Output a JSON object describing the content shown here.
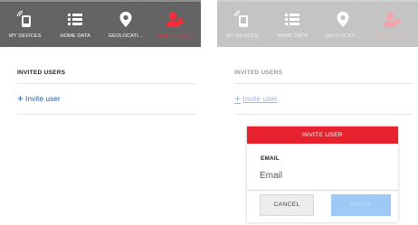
{
  "colors": {
    "tabbar_bg": "#646464",
    "tabbar_faded_bg": "#c4c4c4",
    "active_red": "#ff2a3a",
    "dialog_header_red": "#e8212e",
    "link_blue": "#1f5fa8",
    "submit_blue": "#9ec9f4"
  },
  "tabs": [
    {
      "label": "MY DEVICES",
      "icon": "devices-icon"
    },
    {
      "label": "HOME DATA",
      "icon": "list-icon"
    },
    {
      "label": "GEOLOCATI...",
      "icon": "location-pin-icon"
    },
    {
      "label": "INVITE USERS",
      "icon": "add-user-icon",
      "active": true
    }
  ],
  "invited": {
    "title": "INVITED USERS",
    "invite_label": "Invite user",
    "plus_glyph": "+"
  },
  "dialog": {
    "title": "INVITE USER",
    "email_label": "EMAIL",
    "email_placeholder": "Email",
    "cancel_label": "CANCEL",
    "submit_label": "INVITE"
  }
}
